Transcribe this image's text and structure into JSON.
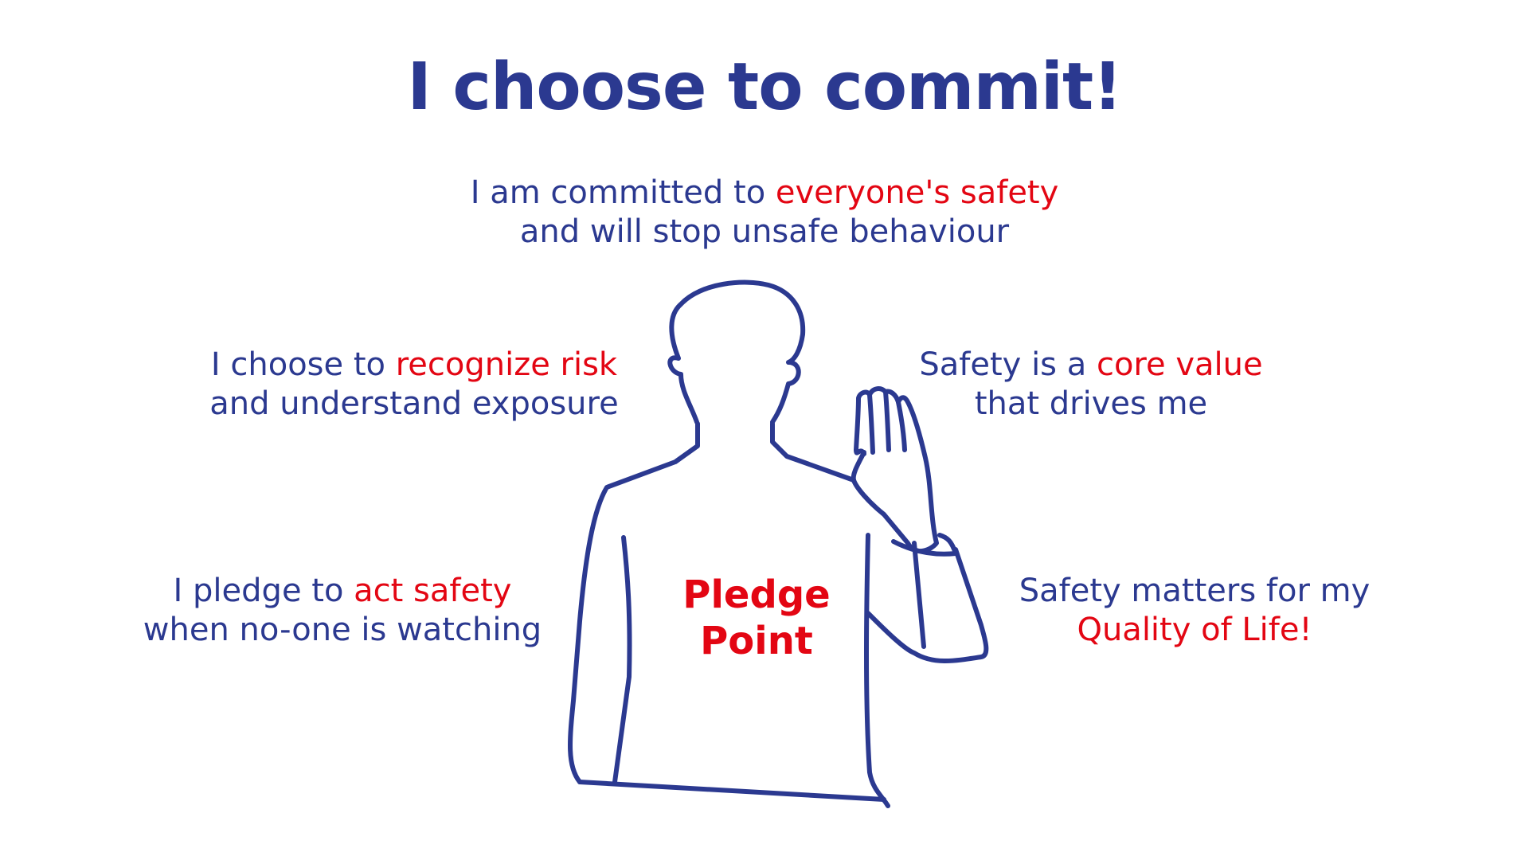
{
  "title": "I choose to commit!",
  "colors": {
    "primary": "#2b3990",
    "accent": "#e30613",
    "background": "#ffffff"
  },
  "statements": {
    "top": {
      "line1_pre": "I am committed to ",
      "line1_highlight": "everyone's safety",
      "line2": "and will stop unsafe behaviour"
    },
    "left1": {
      "line1_pre": "I choose to ",
      "line1_highlight": "recognize risk",
      "line2": "and understand exposure"
    },
    "right1": {
      "line1_pre": "Safety is a ",
      "line1_highlight": "core value",
      "line2": "that drives me"
    },
    "left2": {
      "line1_pre": "I pledge to ",
      "line1_highlight": "act safety",
      "line2": "when no-one is watching"
    },
    "right2": {
      "line1": "Safety matters for my",
      "line2_highlight": "Quality of Life!"
    }
  },
  "figure": {
    "icon": "person-raising-hand-icon",
    "label_line1": "Pledge",
    "label_line2": "Point"
  }
}
